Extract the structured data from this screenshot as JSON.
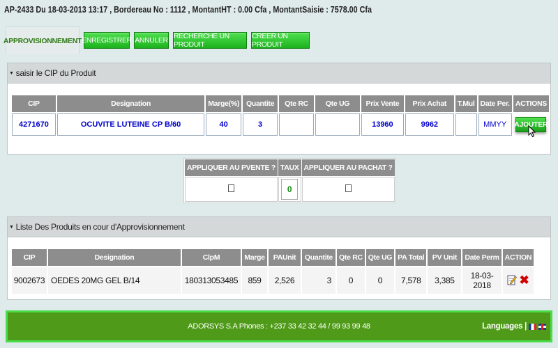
{
  "header": {
    "info": "AP-2433 Du 18-03-2013 13:17 , Bordereau No : 1112 , MontantHT : 0.00 Cfa , MontantSaisie : 7578.00 Cfa"
  },
  "toolbar": {
    "tab_label": "APPROVISIONNEMENT",
    "buttons": [
      "ENREGISTRER",
      "ANNULER",
      "RECHERCHE UN PRODUIT",
      "CREER UN PRODUIT"
    ]
  },
  "cip_section": {
    "title": "saisir le CIP du Produit",
    "columns": [
      "CIP",
      "Designation",
      "Marge(%)",
      "Quantite",
      "Qte RC",
      "Qte UG",
      "Prix Vente",
      "Prix Achat",
      "T.Mul",
      "Date Per.",
      "ACTIONS"
    ],
    "row": {
      "cip": "4271670",
      "designation": "OCUVITE LUTEINE CP B/60",
      "marge": "40",
      "quantite": "3",
      "qte_rc": "",
      "qte_ug": "",
      "prix_vente": "13960",
      "prix_achat": "9962",
      "t_mul": "",
      "date_per_placeholder": "MMYY",
      "action_label": "AJOUTER"
    }
  },
  "apply": {
    "columns": [
      "APPLIQUER AU PVENTE ?",
      "TAUX",
      "APPLIQUER AU PACHAT ?"
    ],
    "taux_value": "0",
    "pvente_checked": false,
    "pachat_checked": false
  },
  "list_section": {
    "title": "Liste Des Produits en cour d'Approvisionnement",
    "columns": [
      "CIP",
      "Designation",
      "ClpM",
      "Marge",
      "PAUnit",
      "Quantite",
      "Qte RC",
      "Qte UG",
      "PA Total",
      "PV Unit",
      "Date Perm",
      "ACTION"
    ],
    "rows": [
      {
        "cip": "9002673",
        "designation": "OEDES 20MG GEL B/14",
        "clpm": "180313053485",
        "marge": "859",
        "paunit": "2,526",
        "quantite": "3",
        "qte_rc": "0",
        "qte_ug": "0",
        "pa_total": "7,578",
        "pv_unit": "3,385",
        "date_perm": "18-03-2018"
      }
    ]
  },
  "footer": {
    "text": "ADORSYS S.A Phones : +237 33 42 32 44 / 99 93 99 48",
    "languages_label": "Languages",
    "separator": "|"
  },
  "colors": {
    "accent_green": "#1db21d",
    "footer_green": "#4f9a18",
    "header_gray": "#8d8d8d",
    "value_blue": "#0000cc"
  }
}
